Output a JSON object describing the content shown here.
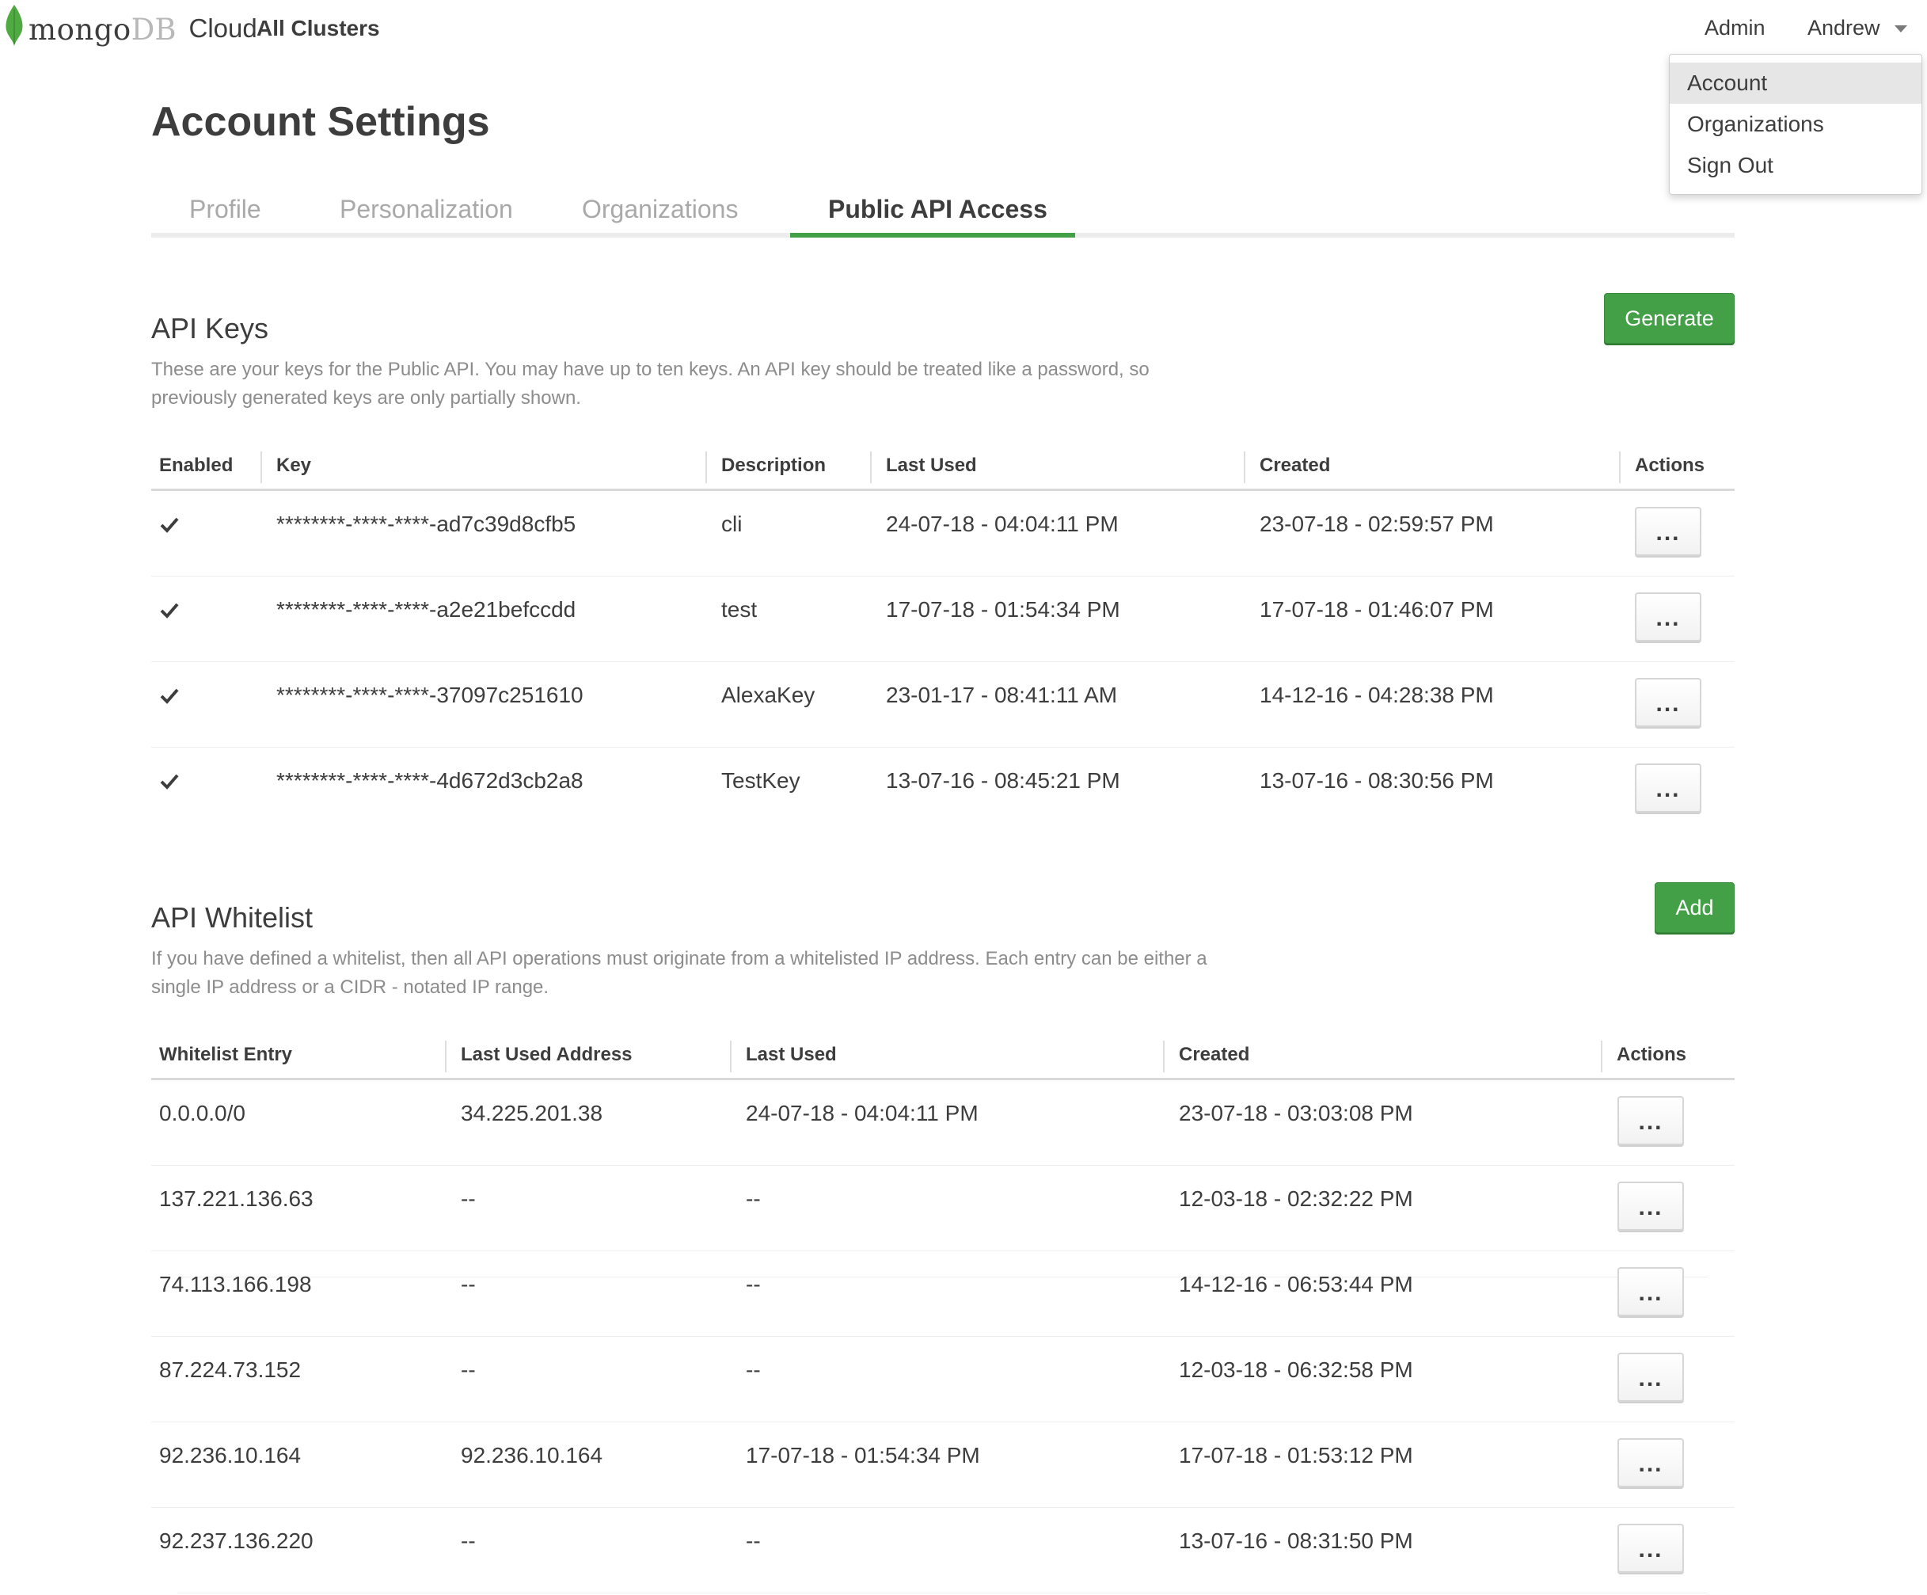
{
  "nav": {
    "logo_mongo": "mongo",
    "logo_db": "DB",
    "logo_cloud": "Cloud",
    "all_clusters": "All Clusters",
    "admin": "Admin",
    "user": "Andrew",
    "brand_green": "#43a047"
  },
  "dropdown": {
    "items": [
      "Account",
      "Organizations",
      "Sign Out"
    ],
    "active": "Account"
  },
  "page_title": "Account Settings",
  "tabs": {
    "items": [
      "Profile",
      "Personalization",
      "Organizations",
      "Public API Access"
    ],
    "active": "Public API Access"
  },
  "api_keys": {
    "title": "API Keys",
    "description_line1": "These are your keys for the Public API. You may have up to ten keys. An API key should be treated like a password, so",
    "description_line2": "previously generated keys are only partially shown.",
    "generate_label": "Generate",
    "columns": [
      "Enabled",
      "Key",
      "Description",
      "Last Used",
      "Created",
      "Actions"
    ],
    "rows": [
      {
        "enabled": true,
        "key": "********-****-****-ad7c39d8cfb5",
        "description": "cli",
        "last_used": "24-07-18 - 04:04:11 PM",
        "created": "23-07-18 - 02:59:57 PM",
        "actions": "..."
      },
      {
        "enabled": true,
        "key": "********-****-****-a2e21befccdd",
        "description": "test",
        "last_used": "17-07-18 - 01:54:34 PM",
        "created": "17-07-18 - 01:46:07 PM",
        "actions": "..."
      },
      {
        "enabled": true,
        "key": "********-****-****-37097c251610",
        "description": "AlexaKey",
        "last_used": "23-01-17 - 08:41:11 AM",
        "created": "14-12-16 - 04:28:38 PM",
        "actions": "..."
      },
      {
        "enabled": true,
        "key": "********-****-****-4d672d3cb2a8",
        "description": "TestKey",
        "last_used": "13-07-16 - 08:45:21 PM",
        "created": "13-07-16 - 08:30:56 PM",
        "actions": "..."
      }
    ]
  },
  "api_whitelist": {
    "title": "API Whitelist",
    "description_line1": "If you have defined a whitelist, then all API operations must originate from a whitelisted IP address. Each entry can be either a",
    "description_line2": "single IP address or a CIDR - notated IP range.",
    "add_label": "Add",
    "columns": [
      "Whitelist Entry",
      "Last Used Address",
      "Last Used",
      "Created",
      "Actions"
    ],
    "rows": [
      {
        "entry": "0.0.0.0/0",
        "last_used_address": "34.225.201.38",
        "last_used": "24-07-18 - 04:04:11 PM",
        "created": "23-07-18 - 03:03:08 PM",
        "actions": "..."
      },
      {
        "entry": "137.221.136.63",
        "last_used_address": "--",
        "last_used": "--",
        "created": "12-03-18 - 02:32:22 PM",
        "actions": "..."
      },
      {
        "entry": "74.113.166.198",
        "last_used_address": "--",
        "last_used": "--",
        "created": "14-12-16 - 06:53:44 PM",
        "actions": "..."
      },
      {
        "entry": "87.224.73.152",
        "last_used_address": "--",
        "last_used": "--",
        "created": "12-03-18 - 06:32:58 PM",
        "actions": "..."
      },
      {
        "entry": "92.236.10.164",
        "last_used_address": "92.236.10.164",
        "last_used": "17-07-18 - 01:54:34 PM",
        "created": "17-07-18 - 01:53:12 PM",
        "actions": "..."
      },
      {
        "entry": "92.237.136.220",
        "last_used_address": "--",
        "last_used": "--",
        "created": "13-07-16 - 08:31:50 PM",
        "actions": "..."
      }
    ]
  }
}
